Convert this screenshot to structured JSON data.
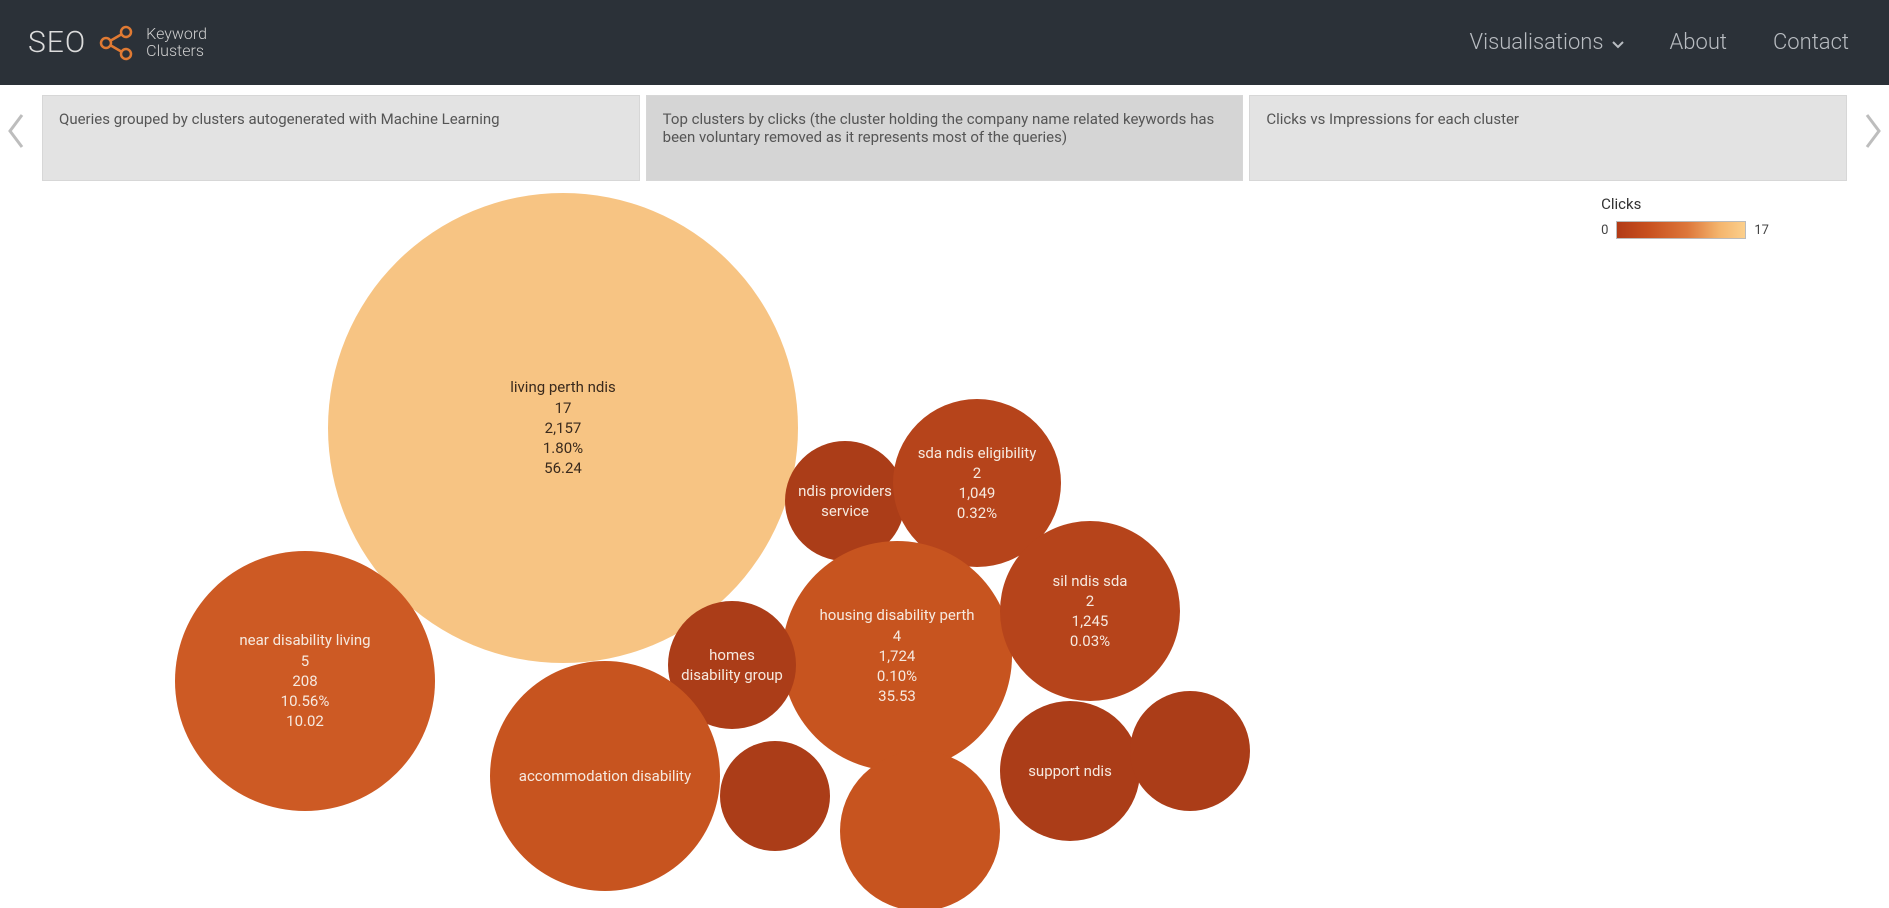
{
  "header": {
    "brand_seo": "SEO",
    "brand_line1": "Keyword",
    "brand_line2": "Clusters",
    "nav": {
      "visualisations": "Visualisations",
      "about": "About",
      "contact": "Contact"
    }
  },
  "tabs": {
    "t0": "Queries grouped by clusters autogenerated with Machine Learning",
    "t1": "Top clusters by clicks (the cluster holding the company name related keywords has been voluntary removed as it represents most of the queries)",
    "t2": "Clicks vs Impressions for each cluster"
  },
  "legend": {
    "title": "Clicks",
    "min": "0",
    "max": "17"
  },
  "chart_data": {
    "type": "bubble",
    "color_scale": {
      "metric": "clicks",
      "min": 0,
      "max": 17,
      "low_color": "#b23a16",
      "high_color": "#fccf8b"
    },
    "value_fields": [
      "clicks",
      "impressions",
      "ctr_percent",
      "position"
    ],
    "bubbles": [
      {
        "id": "living_perth_ndis",
        "label": "living perth ndis",
        "clicks": 17,
        "impressions": 2157,
        "ctr_percent": 1.8,
        "position": 56.24
      },
      {
        "id": "near_disability_living",
        "label": "near disability living",
        "clicks": 5,
        "impressions": 208,
        "ctr_percent": 10.56,
        "position": 10.02
      },
      {
        "id": "housing_disability_perth",
        "label": "housing disability perth",
        "clicks": 4,
        "impressions": 1724,
        "ctr_percent": 0.1,
        "position": 35.53
      },
      {
        "id": "sda_ndis_eligibility",
        "label": "sda ndis eligibility",
        "clicks": 2,
        "impressions": 1049,
        "ctr_percent": 0.32,
        "position": null
      },
      {
        "id": "sil_ndis_sda",
        "label": "sil ndis sda",
        "clicks": 2,
        "impressions": 1245,
        "ctr_percent": 0.03,
        "position": null
      },
      {
        "id": "ndis_providers_service",
        "label": "ndis providers service",
        "clicks": null,
        "impressions": null,
        "ctr_percent": null,
        "position": null
      },
      {
        "id": "homes_disability_group",
        "label": "homes disability group",
        "clicks": null,
        "impressions": null,
        "ctr_percent": null,
        "position": null
      },
      {
        "id": "accommodation_disability",
        "label": "accommodation disability",
        "clicks": null,
        "impressions": null,
        "ctr_percent": null,
        "position": null
      },
      {
        "id": "support_ndis",
        "label": "support ndis",
        "clicks": null,
        "impressions": null,
        "ctr_percent": null,
        "position": null
      }
    ]
  },
  "bubbles_text": {
    "living_perth_ndis": {
      "l1": "living perth ndis",
      "l2": "17",
      "l3": "2,157",
      "l4": "1.80%",
      "l5": "56.24"
    },
    "near_disability_living": {
      "l1": "near disability living",
      "l2": "5",
      "l3": "208",
      "l4": "10.56%",
      "l5": "10.02"
    },
    "housing_disability_perth": {
      "l1": "housing disability perth",
      "l2": "4",
      "l3": "1,724",
      "l4": "0.10%",
      "l5": "35.53"
    },
    "sda_ndis_eligibility": {
      "l1": "sda ndis eligibility",
      "l2": "2",
      "l3": "1,049",
      "l4": "0.32%"
    },
    "sil_ndis_sda": {
      "l1": "sil ndis sda",
      "l2": "2",
      "l3": "1,245",
      "l4": "0.03%"
    },
    "ndis_providers_service": {
      "l1": "ndis providers",
      "l2": "service"
    },
    "homes_disability_group": {
      "l1": "homes",
      "l2": "disability group"
    },
    "accommodation_disability": {
      "l1": "accommodation disability"
    },
    "support_ndis": {
      "l1": "support ndis"
    }
  }
}
